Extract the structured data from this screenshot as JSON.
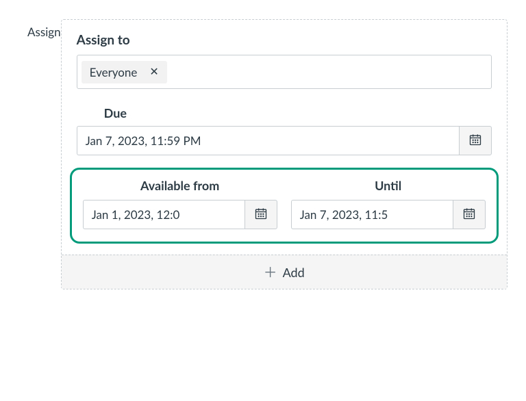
{
  "leftLabel": "Assign",
  "assignTo": {
    "label": "Assign to",
    "tokens": [
      "Everyone"
    ]
  },
  "due": {
    "label": "Due",
    "value": "Jan 7, 2023, 11:59 PM"
  },
  "availableFrom": {
    "label": "Available from",
    "value": "Jan 1, 2023, 12:0"
  },
  "until": {
    "label": "Until",
    "value": "Jan 7, 2023, 11:5"
  },
  "addLabel": "Add"
}
